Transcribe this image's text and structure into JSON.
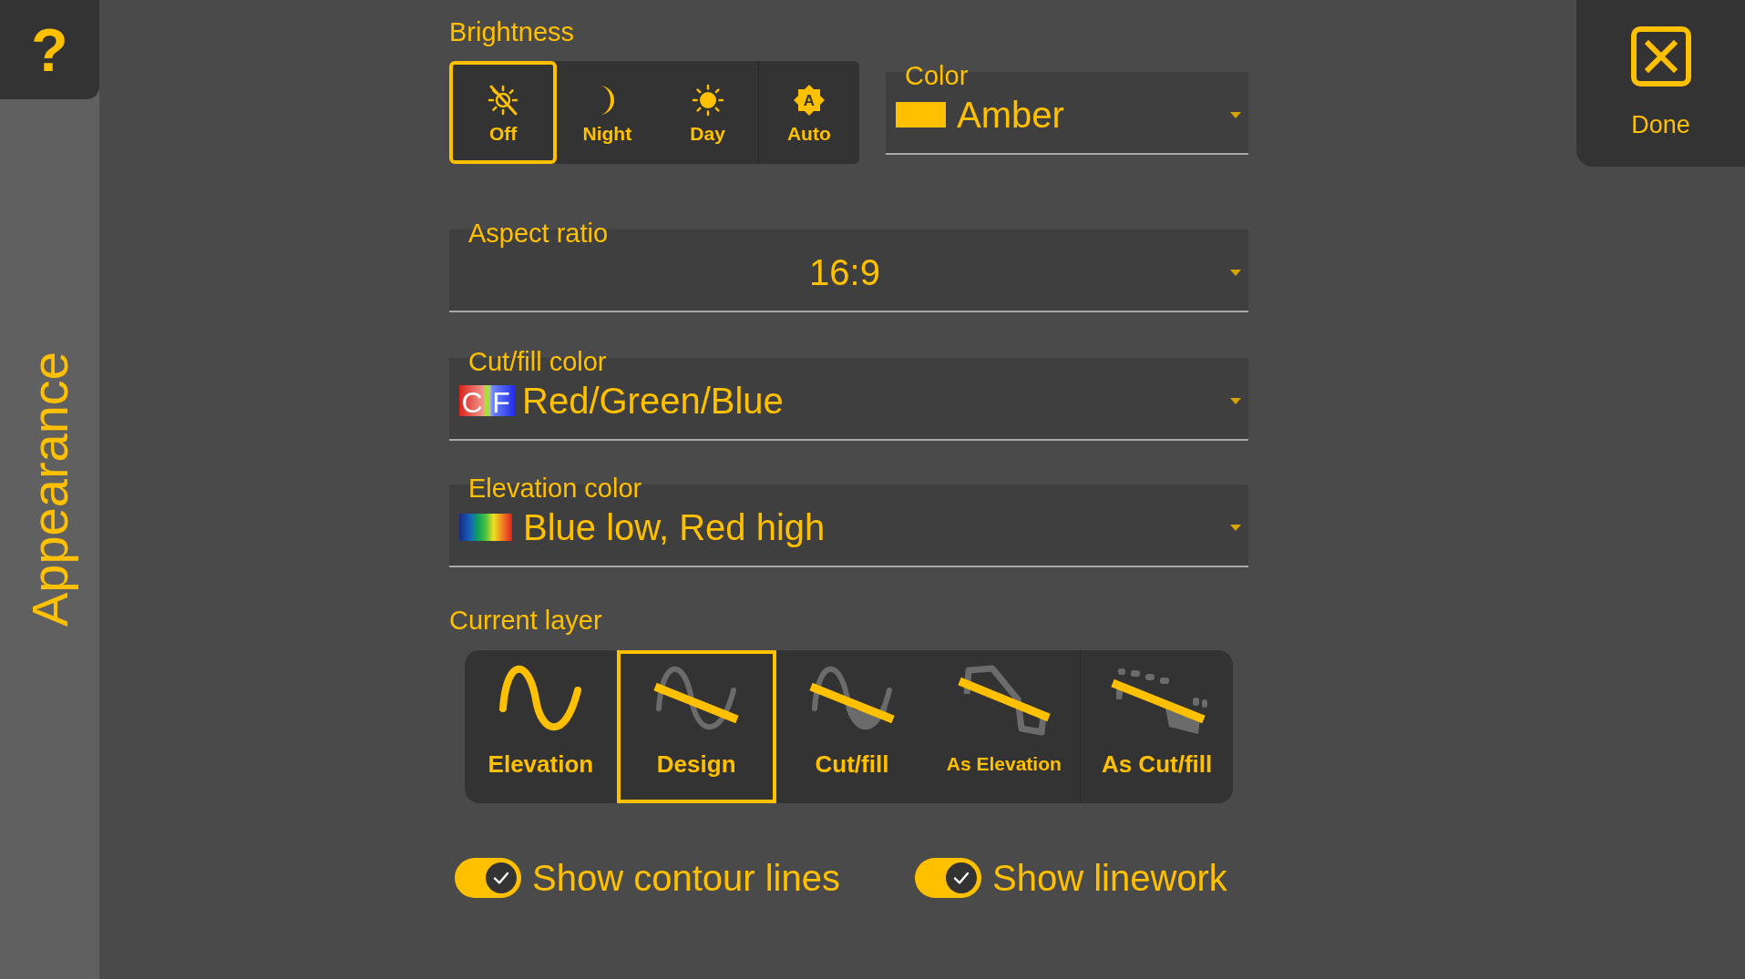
{
  "help_button": {
    "label": "?"
  },
  "sidebar": {
    "title": "Appearance"
  },
  "brightness": {
    "label": "Brightness",
    "options": [
      {
        "kind": "off",
        "label": "Off",
        "selected": true
      },
      {
        "kind": "night",
        "label": "Night",
        "selected": false
      },
      {
        "kind": "day",
        "label": "Day",
        "selected": false
      },
      {
        "kind": "auto",
        "label": "Auto",
        "glyph": "A",
        "selected": false
      }
    ]
  },
  "color": {
    "label": "Color",
    "value": "Amber",
    "color": "#ffc000"
  },
  "done_button": {
    "label": "Done"
  },
  "aspect_ratio": {
    "label": "Aspect ratio",
    "value": "16:9"
  },
  "cut_fill_color": {
    "label": "Cut/fill color",
    "value": "Red/Green/Blue",
    "swatch_letters": [
      "C",
      "F"
    ]
  },
  "elevation_color": {
    "label": "Elevation color",
    "value": "Blue low, Red high"
  },
  "current_layer": {
    "label": "Current layer",
    "options": [
      {
        "kind": "elevation",
        "label": "Elevation",
        "selected": false
      },
      {
        "kind": "design",
        "label": "Design",
        "selected": true
      },
      {
        "kind": "cut_fill",
        "label": "Cut/fill",
        "selected": false
      },
      {
        "kind": "as_elevation",
        "label": "As Elevation",
        "selected": false
      },
      {
        "kind": "as_cut_fill",
        "label": "As Cut/fill",
        "selected": false
      }
    ]
  },
  "toggles": [
    {
      "label": "Show contour lines",
      "on": true
    },
    {
      "label": "Show linework",
      "on": true
    }
  ]
}
